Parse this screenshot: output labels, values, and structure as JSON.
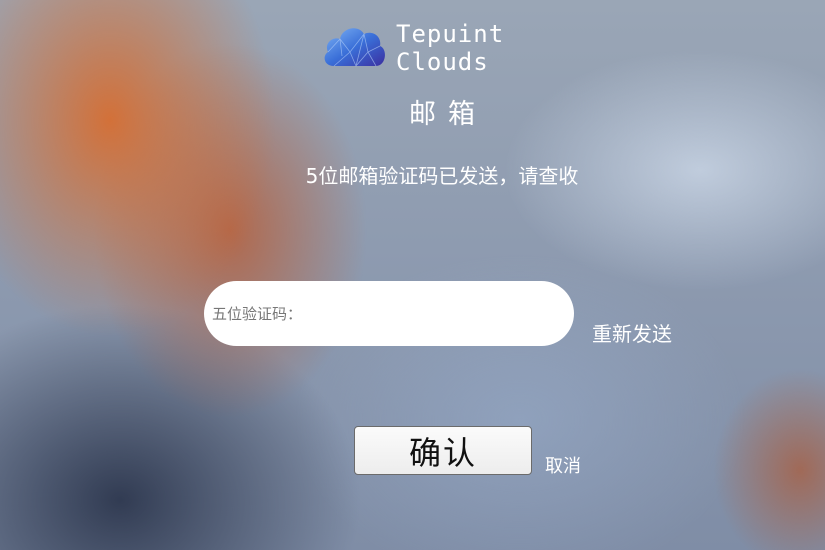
{
  "header": {
    "brand_name": "Tepuint Clouds",
    "logo_icon": "cloud-icon"
  },
  "page": {
    "title": "邮箱",
    "status_message": "5位邮箱验证码已发送，请查收"
  },
  "form": {
    "code_placeholder": "五位验证码：",
    "code_value": "",
    "resend_label": "重新发送",
    "confirm_label": "确认",
    "cancel_label": "取消"
  },
  "colors": {
    "text": "#ffffff",
    "input_background": "#ffffff",
    "button_background": "#f4f4f4",
    "logo_cloud": "#3a6fd8"
  }
}
